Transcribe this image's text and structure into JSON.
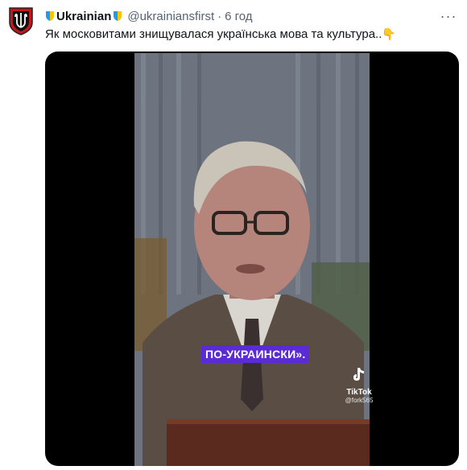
{
  "author": {
    "name": "Ukrainian",
    "handle": "@ukrainiansfirst",
    "separator": "·",
    "time": "6 год"
  },
  "tweet": {
    "text": "Як московитами знищувалася українська мова та культура..",
    "emoji": "👇"
  },
  "menu": {
    "more_label": "···"
  },
  "video": {
    "caption": "ПО-УКРАИНСКИ».",
    "watermark_brand": "TikTok",
    "watermark_user": "@fork565"
  },
  "icons": {
    "avatar": "trident-emblem-icon",
    "name_badge_left": "shield-badge-icon",
    "name_badge_right": "shield-badge-icon",
    "more": "more-horizontal-icon",
    "tiktok": "tiktok-logo-icon"
  },
  "colors": {
    "text": "#0f1419",
    "secondary": "#536471",
    "caption_bg": "#5b2bd6",
    "media_bg": "#000000",
    "badge_blue": "#1d9bf0",
    "badge_yellow": "#f7c600"
  }
}
